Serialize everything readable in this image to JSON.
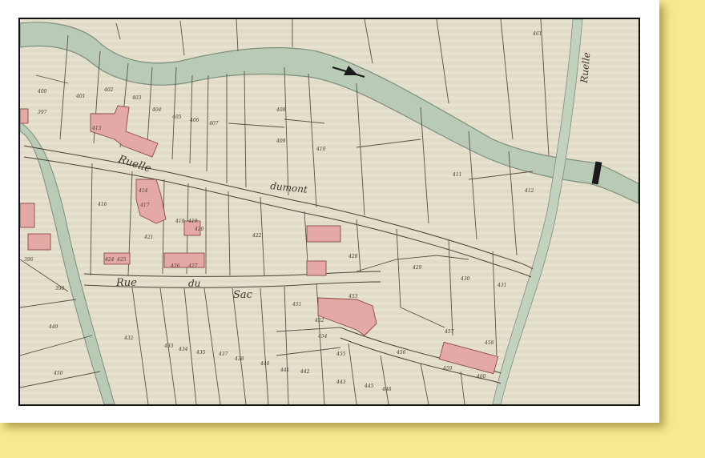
{
  "map": {
    "street_labels": [
      "Ruelle",
      "dumont",
      "Rue",
      "du",
      "Sac",
      "Ruelle"
    ],
    "parcel_numbers": [
      "396",
      "397",
      "398",
      "400",
      "401",
      "402",
      "403",
      "404",
      "405",
      "406",
      "407",
      "408",
      "409",
      "410",
      "411",
      "412",
      "413",
      "414",
      "416",
      "417",
      "418",
      "419",
      "420",
      "421",
      "422",
      "424",
      "425",
      "426",
      "427",
      "428",
      "429",
      "430",
      "431",
      "432",
      "433",
      "434",
      "435",
      "437",
      "438",
      "440",
      "441",
      "442",
      "443",
      "445",
      "448",
      "449",
      "450",
      "451",
      "452",
      "453",
      "454",
      "455",
      "456",
      "457",
      "458",
      "459",
      "460",
      "461"
    ],
    "colors": {
      "paper": "#e5e0cc",
      "building": "#e4a9a5",
      "building_stroke": "#8a4a44",
      "water": "#b9cbb6",
      "water_stroke": "#7c8f7a",
      "ink": "#3b3328"
    },
    "icons": [
      "flow-arrow-icon",
      "bridge-icon"
    ]
  }
}
